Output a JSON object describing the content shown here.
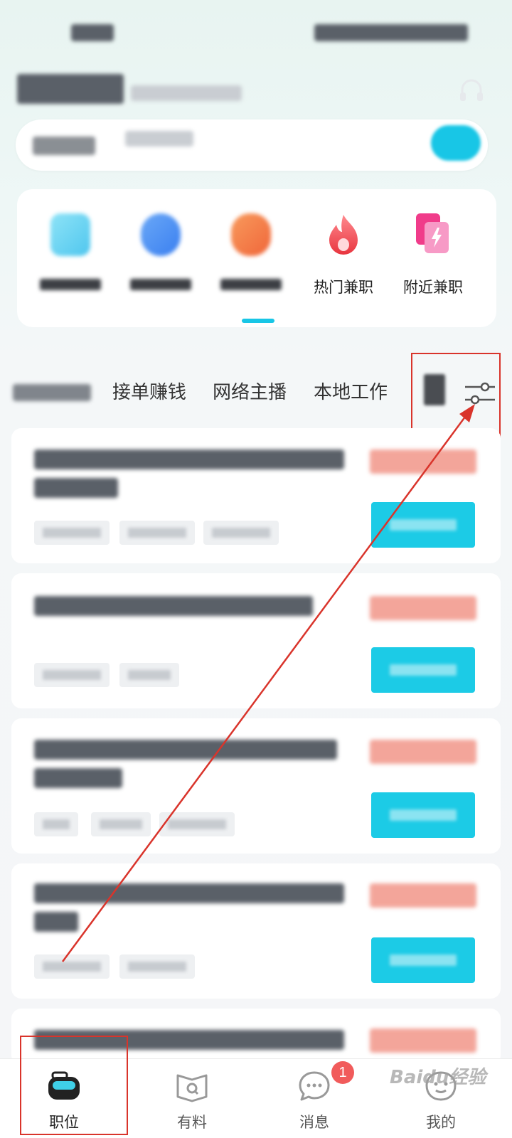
{
  "categories": [
    {
      "label": "",
      "icon": "blue-square-icon",
      "color": "#5fd0ee"
    },
    {
      "label": "",
      "icon": "blue-blob-icon",
      "color": "#4f8ef2"
    },
    {
      "label": "",
      "icon": "orange-blob-icon",
      "color": "#f2783f"
    },
    {
      "label": "热门兼职",
      "icon": "flame-icon",
      "color": "#ef4b5a"
    },
    {
      "label": "附近兼职",
      "icon": "lightning-card-icon",
      "color": "#f05aa5"
    }
  ],
  "tabs": [
    "接单赚钱",
    "网络主播",
    "本地工作"
  ],
  "nav": {
    "items": [
      {
        "label": "职位",
        "icon": "briefcase-icon",
        "active": true
      },
      {
        "label": "有料",
        "icon": "book-icon",
        "active": false
      },
      {
        "label": "消息",
        "icon": "chat-icon",
        "active": false
      },
      {
        "label": "我的",
        "icon": "profile-icon",
        "active": false
      }
    ],
    "message_badge": "1"
  },
  "colors": {
    "accent": "#1ccbe6",
    "salary": "#f3a59a",
    "annotation": "#d9342b",
    "badge": "#f15b5b"
  },
  "watermark": "Baidu经验"
}
